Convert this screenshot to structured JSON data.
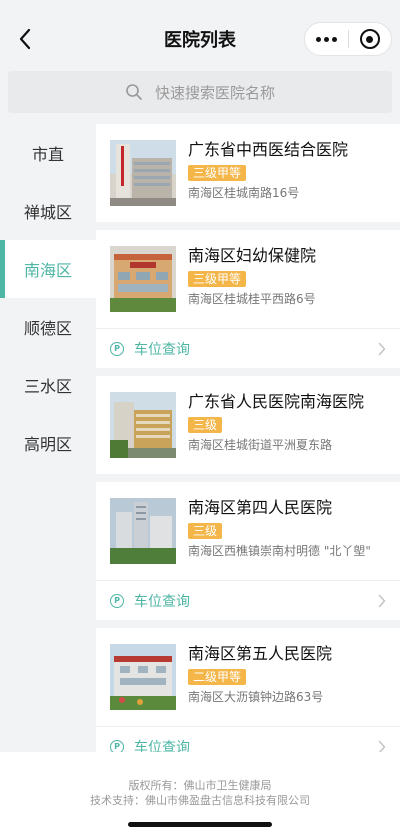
{
  "header": {
    "title": "医院列表"
  },
  "search": {
    "placeholder": "快速搜索医院名称"
  },
  "sidebar": {
    "items": [
      {
        "label": "市直",
        "active": false
      },
      {
        "label": "禅城区",
        "active": false
      },
      {
        "label": "南海区",
        "active": true
      },
      {
        "label": "顺德区",
        "active": false
      },
      {
        "label": "三水区",
        "active": false
      },
      {
        "label": "高明区",
        "active": false
      }
    ]
  },
  "hospitals": [
    {
      "name": "广东省中西医结合医院",
      "level": "三级甲等",
      "address": "南海区桂城南路16号",
      "parking": ""
    },
    {
      "name": "南海区妇幼保健院",
      "level": "三级甲等",
      "address": "南海区桂城桂平西路6号",
      "parking": "车位查询"
    },
    {
      "name": "广东省人民医院南海医院",
      "level": "三级",
      "address": "南海区桂城街道平洲夏东路",
      "parking": ""
    },
    {
      "name": "南海区第四人民医院",
      "level": "三级",
      "address": "南海区西樵镇崇南村明德 \"北丫塱\"",
      "parking": "车位查询"
    },
    {
      "name": "南海区第五人民医院",
      "level": "二级甲等",
      "address": "南海区大沥镇钟边路63号",
      "parking": "车位查询"
    }
  ],
  "footer": {
    "copyright": "版权所有：佛山市卫生健康局",
    "support": "技术支持：佛山市佛盈盘古信息科技有限公司"
  },
  "colors": {
    "accent": "#4db6a4",
    "badge": "#f4b549",
    "background": "#f2f3f5"
  }
}
